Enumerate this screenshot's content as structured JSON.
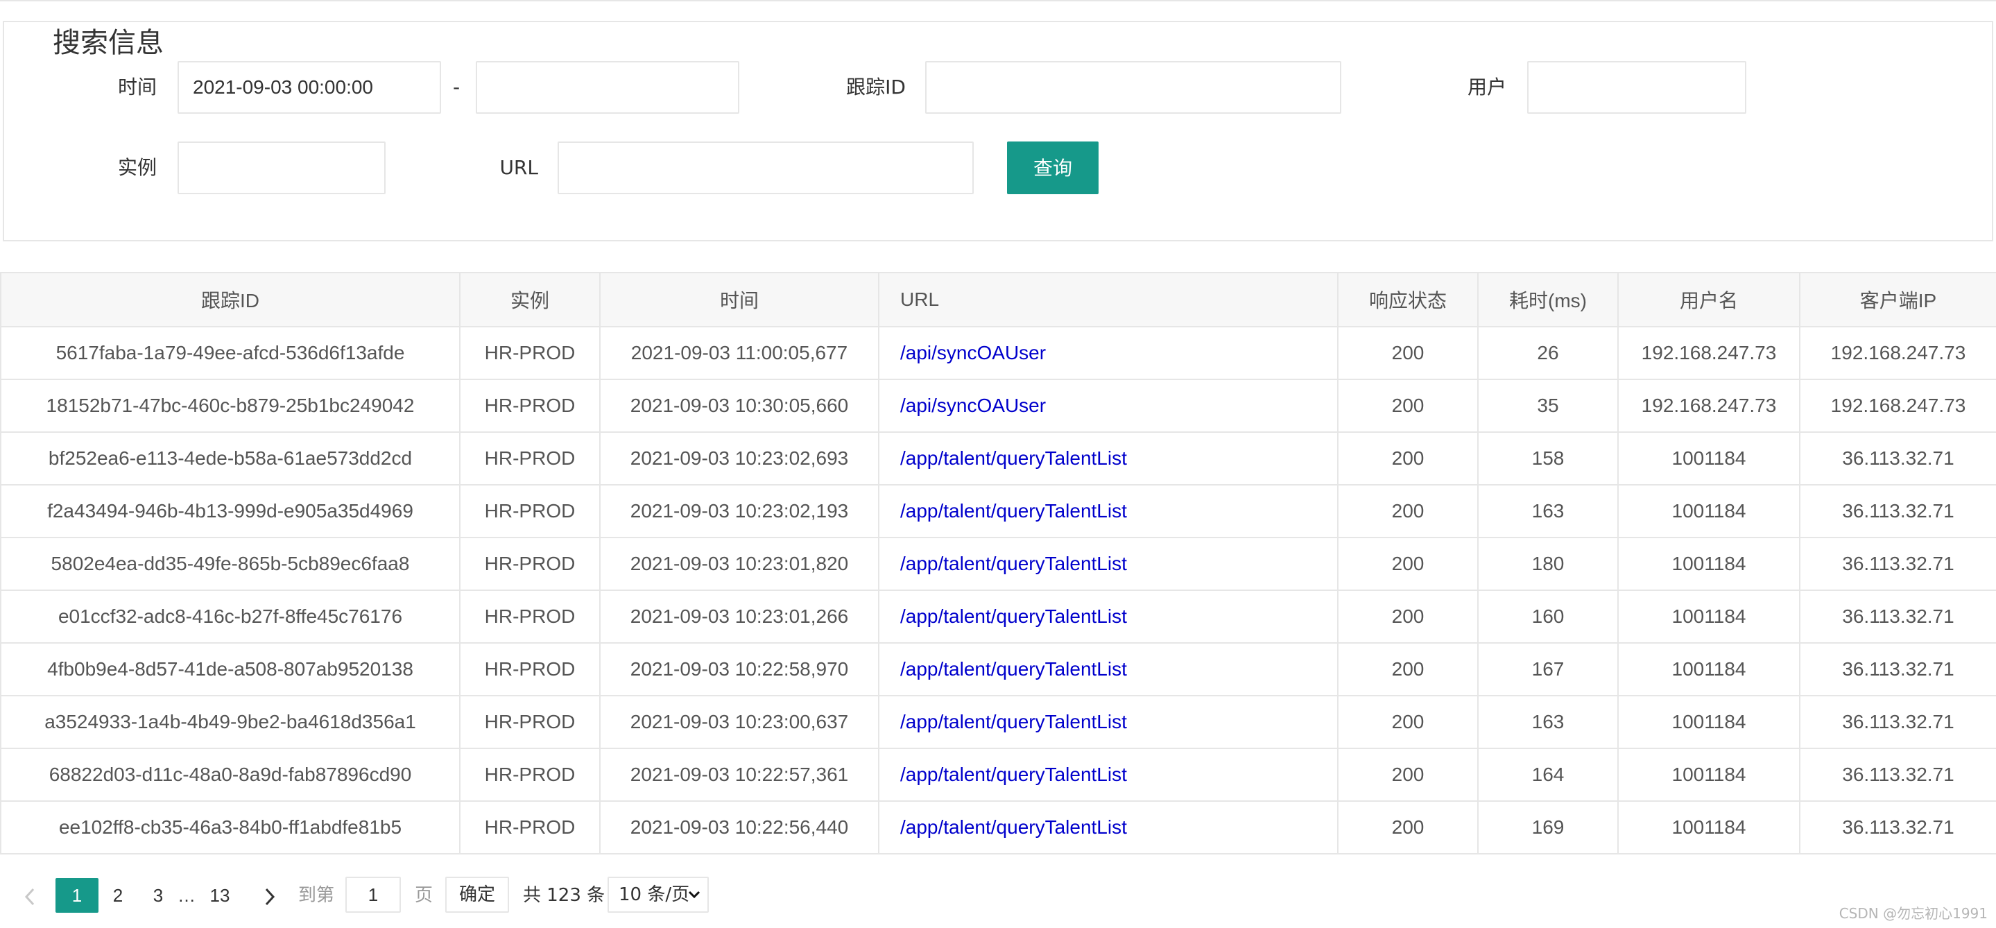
{
  "search": {
    "legend": "搜索信息",
    "time_label": "时间",
    "time_start": "2021-09-03 00:00:00",
    "time_end": "",
    "range_sep": "-",
    "trace_label": "跟踪ID",
    "trace_value": "",
    "user_label": "用户",
    "user_value": "",
    "instance_label": "实例",
    "instance_value": "",
    "url_label": "URL",
    "url_value": "",
    "query_button": "查询"
  },
  "table": {
    "headers": [
      "跟踪ID",
      "实例",
      "时间",
      "URL",
      "响应状态",
      "耗时(ms)",
      "用户名",
      "客户端IP"
    ],
    "rows": [
      [
        "5617faba-1a79-49ee-afcd-536d6f13afde",
        "HR-PROD",
        "2021-09-03 11:00:05,677",
        "/api/syncOAUser",
        "200",
        "26",
        "192.168.247.73",
        "192.168.247.73"
      ],
      [
        "18152b71-47bc-460c-b879-25b1bc249042",
        "HR-PROD",
        "2021-09-03 10:30:05,660",
        "/api/syncOAUser",
        "200",
        "35",
        "192.168.247.73",
        "192.168.247.73"
      ],
      [
        "bf252ea6-e113-4ede-b58a-61ae573dd2cd",
        "HR-PROD",
        "2021-09-03 10:23:02,693",
        "/app/talent/queryTalentList",
        "200",
        "158",
        "1001184",
        "36.113.32.71"
      ],
      [
        "f2a43494-946b-4b13-999d-e905a35d4969",
        "HR-PROD",
        "2021-09-03 10:23:02,193",
        "/app/talent/queryTalentList",
        "200",
        "163",
        "1001184",
        "36.113.32.71"
      ],
      [
        "5802e4ea-dd35-49fe-865b-5cb89ec6faa8",
        "HR-PROD",
        "2021-09-03 10:23:01,820",
        "/app/talent/queryTalentList",
        "200",
        "180",
        "1001184",
        "36.113.32.71"
      ],
      [
        "e01ccf32-adc8-416c-b27f-8ffe45c76176",
        "HR-PROD",
        "2021-09-03 10:23:01,266",
        "/app/talent/queryTalentList",
        "200",
        "160",
        "1001184",
        "36.113.32.71"
      ],
      [
        "4fb0b9e4-8d57-41de-a508-807ab9520138",
        "HR-PROD",
        "2021-09-03 10:22:58,970",
        "/app/talent/queryTalentList",
        "200",
        "167",
        "1001184",
        "36.113.32.71"
      ],
      [
        "a3524933-1a4b-4b49-9be2-ba4618d356a1",
        "HR-PROD",
        "2021-09-03 10:23:00,637",
        "/app/talent/queryTalentList",
        "200",
        "163",
        "1001184",
        "36.113.32.71"
      ],
      [
        "68822d03-d11c-48a0-8a9d-fab87896cd90",
        "HR-PROD",
        "2021-09-03 10:22:57,361",
        "/app/talent/queryTalentList",
        "200",
        "164",
        "1001184",
        "36.113.32.71"
      ],
      [
        "ee102ff8-cb35-46a3-84b0-ff1abdfe81b5",
        "HR-PROD",
        "2021-09-03 10:22:56,440",
        "/app/talent/queryTalentList",
        "200",
        "169",
        "1001184",
        "36.113.32.71"
      ]
    ]
  },
  "pagination": {
    "pages": [
      "1",
      "2",
      "3"
    ],
    "ellipsis": "…",
    "last_page": "13",
    "goto_prefix": "到第",
    "goto_value": "1",
    "goto_suffix": "页",
    "confirm": "确定",
    "total": "共 123 条",
    "page_size": "10 条/页",
    "current_color": "#16998a"
  },
  "watermark": "CSDN @勿忘初心1991"
}
